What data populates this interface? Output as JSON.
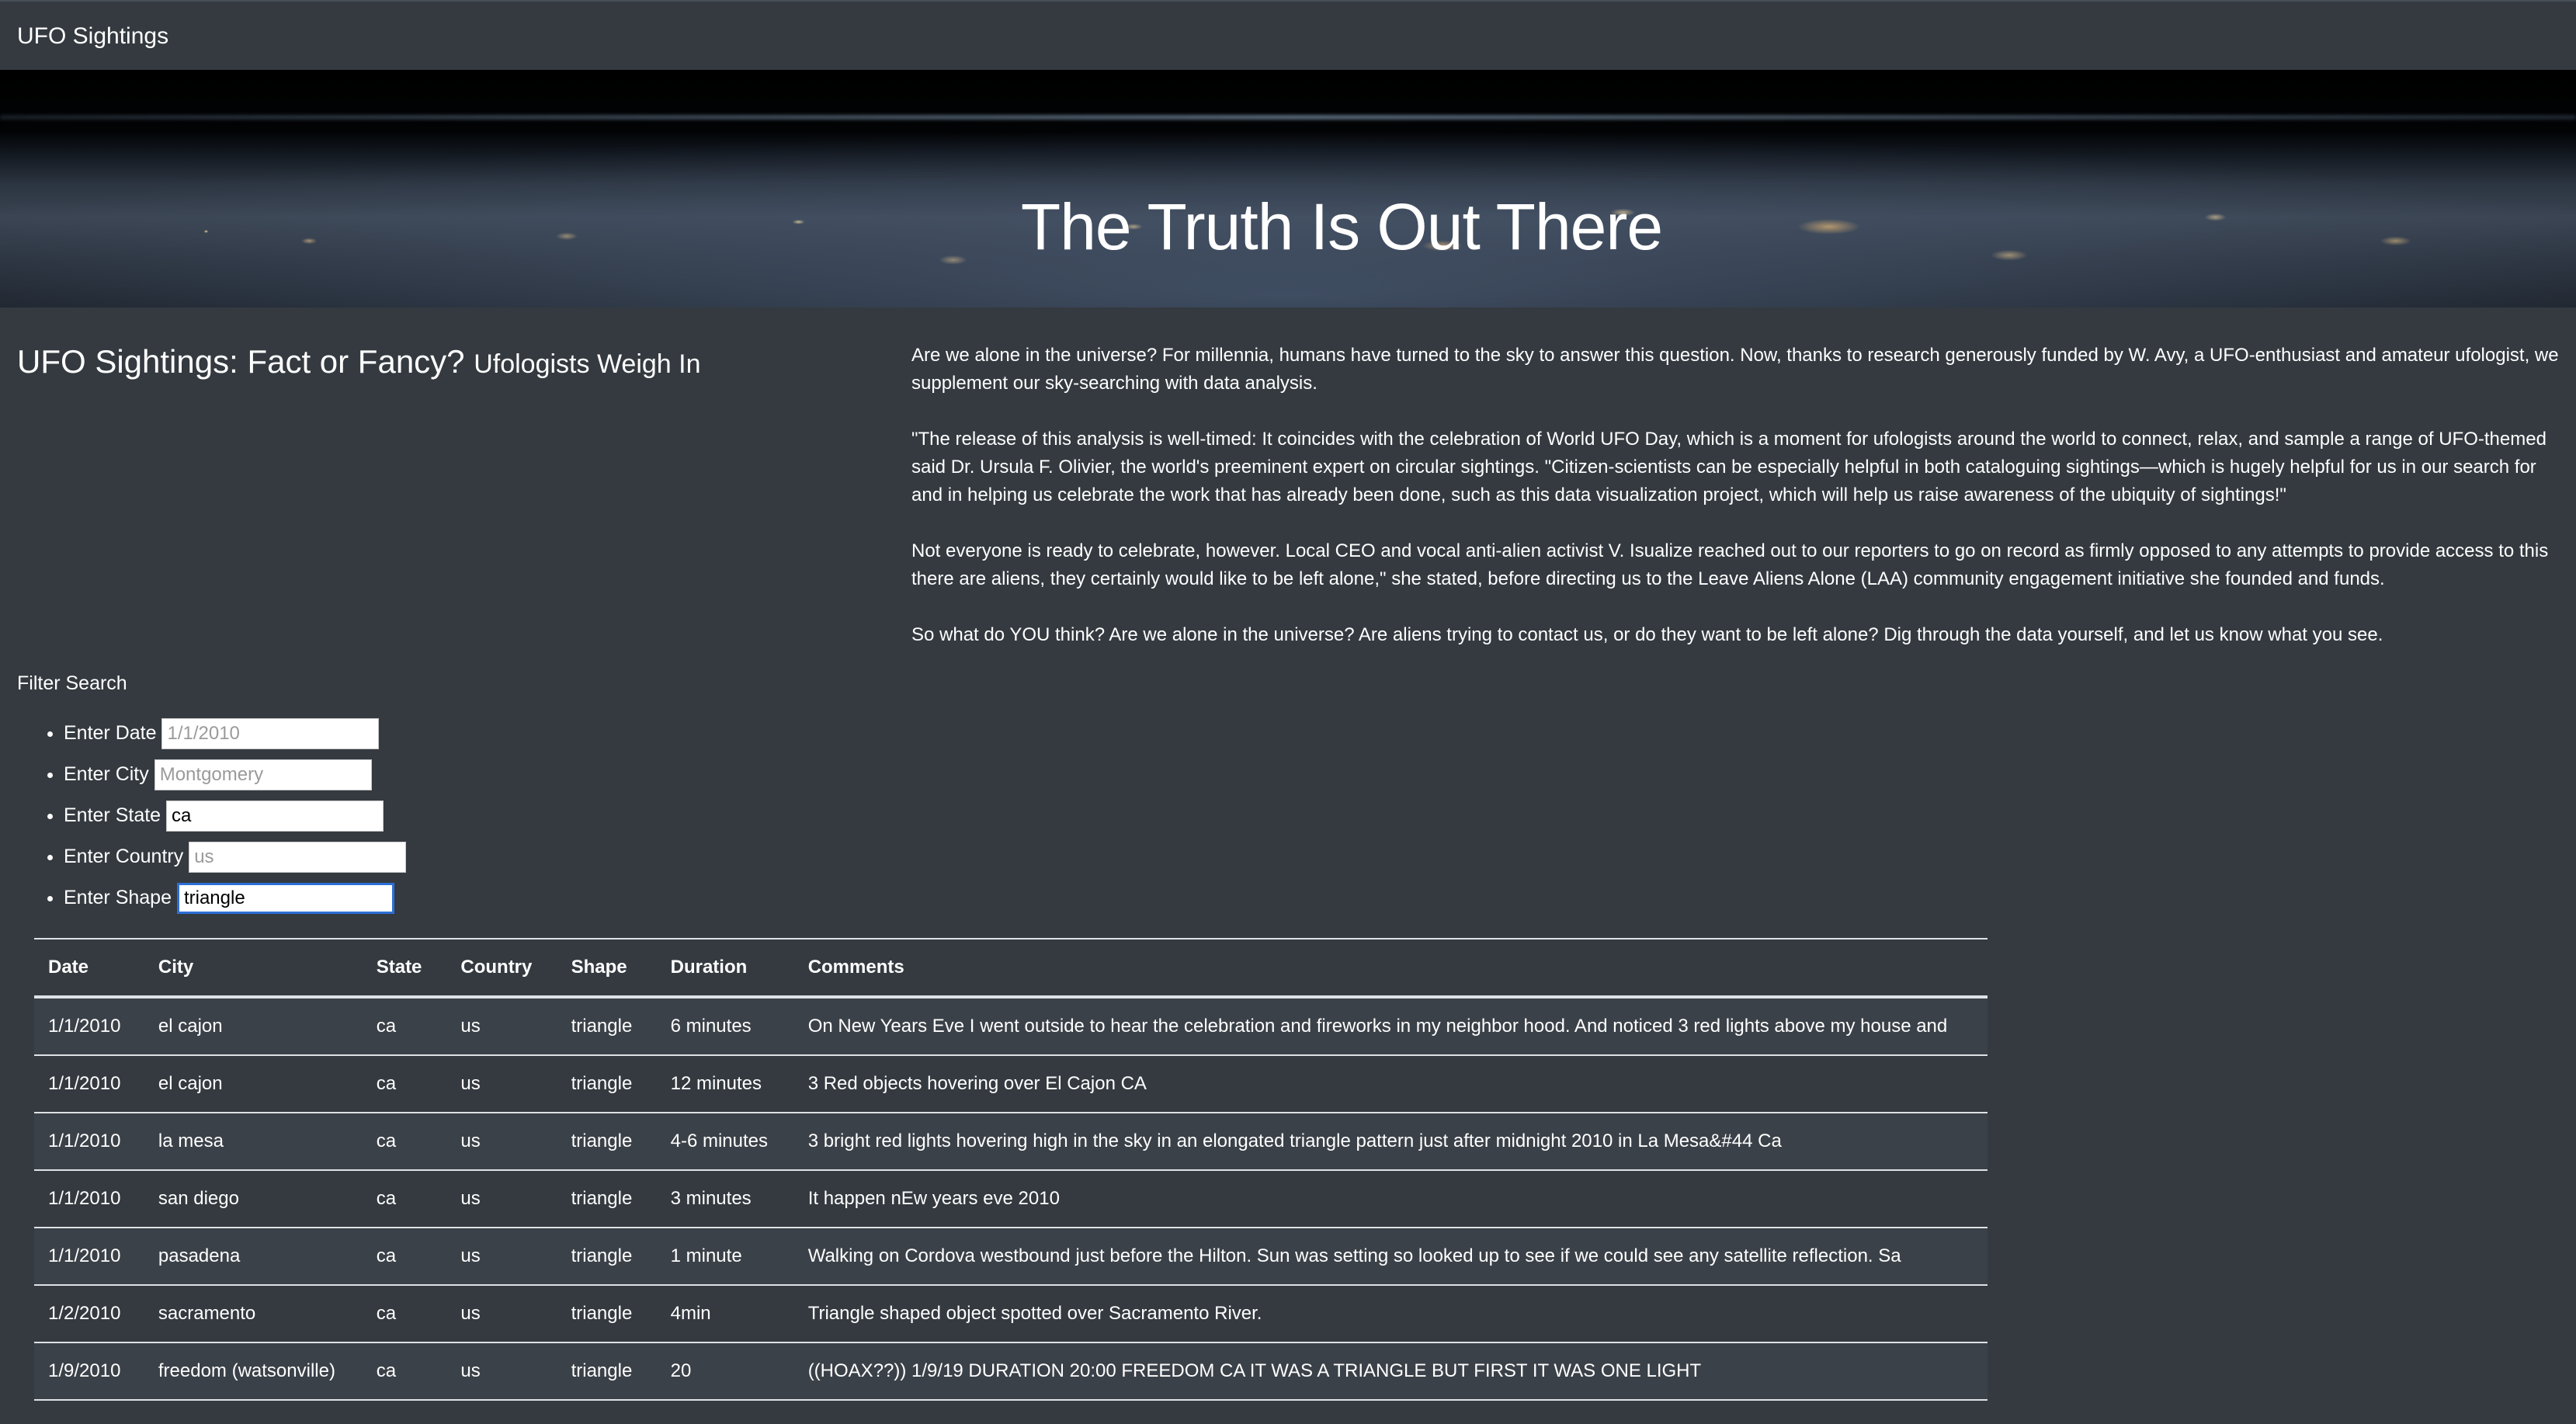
{
  "nav": {
    "brand": "UFO Sightings"
  },
  "hero": {
    "title": "The Truth Is Out There"
  },
  "article": {
    "heading": "UFO Sightings: Fact or Fancy?",
    "subheading": "Ufologists Weigh In",
    "paragraphs": [
      {
        "lines": [
          "Are we alone in the universe? For millennia, humans have turned to the sky to answer this question. Now, thanks to research generously funded by W. Avy, a UFO-enthusiast and amateur ufologist, we",
          "supplement our sky-searching with data analysis."
        ]
      },
      {
        "lines": [
          "\"The release of this analysis is well-timed: It coincides with the celebration of World UFO Day, which is a moment for ufologists around the world to connect, relax, and sample a range of UFO-themed",
          "said Dr. Ursula F. Olivier, the world's preeminent expert on circular sightings. \"Citizen-scientists can be especially helpful in both cataloguing sightings—which is hugely helpful for us in our search for",
          "and in helping us celebrate the work that has already been done, such as this data visualization project, which will help us raise awareness of the ubiquity of sightings!\""
        ]
      },
      {
        "lines": [
          "Not everyone is ready to celebrate, however. Local CEO and vocal anti-alien activist V. Isualize reached out to our reporters to go on record as firmly opposed to any attempts to provide access to this",
          "there are aliens, they certainly would like to be left alone,\" she stated, before directing us to the Leave Aliens Alone (LAA) community engagement initiative she founded and funds."
        ]
      },
      {
        "lines": [
          "So what do YOU think? Are we alone in the universe? Are aliens trying to contact us, or do they want to be left alone? Dig through the data yourself, and let us know what you see."
        ]
      }
    ]
  },
  "filters": {
    "title": "Filter Search",
    "fields": [
      {
        "label": "Enter Date",
        "placeholder": "1/1/2010",
        "value": ""
      },
      {
        "label": "Enter City",
        "placeholder": "Montgomery",
        "value": ""
      },
      {
        "label": "Enter State",
        "placeholder": "",
        "value": "ca"
      },
      {
        "label": "Enter Country",
        "placeholder": "us",
        "value": ""
      },
      {
        "label": "Enter Shape",
        "placeholder": "",
        "value": "triangle"
      }
    ]
  },
  "table": {
    "columns": [
      "Date",
      "City",
      "State",
      "Country",
      "Shape",
      "Duration",
      "Comments"
    ],
    "rows": [
      [
        "1/1/2010",
        "el cajon",
        "ca",
        "us",
        "triangle",
        "6 minutes",
        "On New Years Eve I went outside to hear the celebration and fireworks in my neighbor hood. And noticed 3 red lights above my house and"
      ],
      [
        "1/1/2010",
        "el cajon",
        "ca",
        "us",
        "triangle",
        "12 minutes",
        "3 Red objects hovering over El Cajon CA"
      ],
      [
        "1/1/2010",
        "la mesa",
        "ca",
        "us",
        "triangle",
        "4-6 minutes",
        "3 bright red lights hovering high in the sky in an elongated triangle pattern just after midnight 2010 in La Mesa&#44 Ca"
      ],
      [
        "1/1/2010",
        "san diego",
        "ca",
        "us",
        "triangle",
        "3 minutes",
        "It happen nEw years eve 2010"
      ],
      [
        "1/1/2010",
        "pasadena",
        "ca",
        "us",
        "triangle",
        "1 minute",
        "Walking on Cordova westbound just before the Hilton. Sun was setting so looked up to see if we could see any satellite reflection. Sa"
      ],
      [
        "1/2/2010",
        "sacramento",
        "ca",
        "us",
        "triangle",
        "4min",
        "Triangle shaped object spotted over Sacramento River."
      ],
      [
        "1/9/2010",
        "freedom (watsonville)",
        "ca",
        "us",
        "triangle",
        "20",
        "((HOAX??)) 1/9/19 DURATION 20:00 FREEDOM CA IT WAS A TRIANGLE BUT FIRST IT WAS ONE LIGHT"
      ]
    ]
  }
}
